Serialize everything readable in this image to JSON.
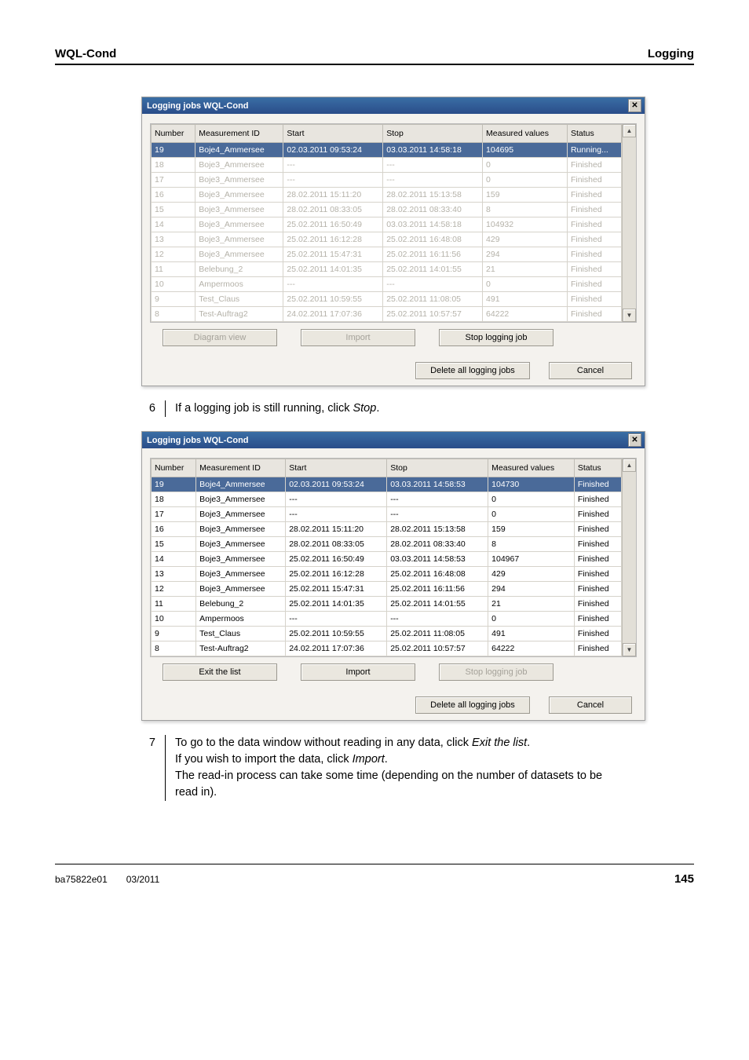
{
  "header": {
    "left": "WQL-Cond",
    "right": "Logging"
  },
  "dialog_title": "Logging jobs WQL-Cond",
  "columns": {
    "number": "Number",
    "id": "Measurement ID",
    "start": "Start",
    "stop": "Stop",
    "values": "Measured values",
    "status": "Status"
  },
  "dialog1": {
    "rows": [
      {
        "n": "19",
        "id": "Boje4_Ammersee",
        "start": "02.03.2011 09:53:24",
        "stop": "03.03.2011 14:58:18",
        "v": "104695",
        "s": "Running...",
        "sel": true
      },
      {
        "n": "18",
        "id": "Boje3_Ammersee",
        "start": "---",
        "stop": "---",
        "v": "0",
        "s": "Finished",
        "dis": true
      },
      {
        "n": "17",
        "id": "Boje3_Ammersee",
        "start": "---",
        "stop": "---",
        "v": "0",
        "s": "Finished",
        "dis": true
      },
      {
        "n": "16",
        "id": "Boje3_Ammersee",
        "start": "28.02.2011 15:11:20",
        "stop": "28.02.2011 15:13:58",
        "v": "159",
        "s": "Finished",
        "dis": true
      },
      {
        "n": "15",
        "id": "Boje3_Ammersee",
        "start": "28.02.2011 08:33:05",
        "stop": "28.02.2011 08:33:40",
        "v": "8",
        "s": "Finished",
        "dis": true
      },
      {
        "n": "14",
        "id": "Boje3_Ammersee",
        "start": "25.02.2011 16:50:49",
        "stop": "03.03.2011 14:58:18",
        "v": "104932",
        "s": "Finished",
        "dis": true
      },
      {
        "n": "13",
        "id": "Boje3_Ammersee",
        "start": "25.02.2011 16:12:28",
        "stop": "25.02.2011 16:48:08",
        "v": "429",
        "s": "Finished",
        "dis": true
      },
      {
        "n": "12",
        "id": "Boje3_Ammersee",
        "start": "25.02.2011 15:47:31",
        "stop": "25.02.2011 16:11:56",
        "v": "294",
        "s": "Finished",
        "dis": true
      },
      {
        "n": "11",
        "id": "Belebung_2",
        "start": "25.02.2011 14:01:35",
        "stop": "25.02.2011 14:01:55",
        "v": "21",
        "s": "Finished",
        "dis": true
      },
      {
        "n": "10",
        "id": "Ampermoos",
        "start": "---",
        "stop": "---",
        "v": "0",
        "s": "Finished",
        "dis": true
      },
      {
        "n": "9",
        "id": "Test_Claus",
        "start": "25.02.2011 10:59:55",
        "stop": "25.02.2011 11:08:05",
        "v": "491",
        "s": "Finished",
        "dis": true
      },
      {
        "n": "8",
        "id": "Test-Auftrag2",
        "start": "24.02.2011 17:07:36",
        "stop": "25.02.2011 10:57:57",
        "v": "64222",
        "s": "Finished",
        "dis": true
      }
    ],
    "buttons": {
      "left": "Diagram view",
      "import": "Import",
      "stop": "Stop logging job",
      "delete": "Delete all logging jobs",
      "cancel": "Cancel"
    }
  },
  "dialog2": {
    "rows": [
      {
        "n": "19",
        "id": "Boje4_Ammersee",
        "start": "02.03.2011 09:53:24",
        "stop": "03.03.2011 14:58:53",
        "v": "104730",
        "s": "Finished",
        "sel": true
      },
      {
        "n": "18",
        "id": "Boje3_Ammersee",
        "start": "---",
        "stop": "---",
        "v": "0",
        "s": "Finished"
      },
      {
        "n": "17",
        "id": "Boje3_Ammersee",
        "start": "---",
        "stop": "---",
        "v": "0",
        "s": "Finished"
      },
      {
        "n": "16",
        "id": "Boje3_Ammersee",
        "start": "28.02.2011 15:11:20",
        "stop": "28.02.2011 15:13:58",
        "v": "159",
        "s": "Finished"
      },
      {
        "n": "15",
        "id": "Boje3_Ammersee",
        "start": "28.02.2011 08:33:05",
        "stop": "28.02.2011 08:33:40",
        "v": "8",
        "s": "Finished"
      },
      {
        "n": "14",
        "id": "Boje3_Ammersee",
        "start": "25.02.2011 16:50:49",
        "stop": "03.03.2011 14:58:53",
        "v": "104967",
        "s": "Finished"
      },
      {
        "n": "13",
        "id": "Boje3_Ammersee",
        "start": "25.02.2011 16:12:28",
        "stop": "25.02.2011 16:48:08",
        "v": "429",
        "s": "Finished"
      },
      {
        "n": "12",
        "id": "Boje3_Ammersee",
        "start": "25.02.2011 15:47:31",
        "stop": "25.02.2011 16:11:56",
        "v": "294",
        "s": "Finished"
      },
      {
        "n": "11",
        "id": "Belebung_2",
        "start": "25.02.2011 14:01:35",
        "stop": "25.02.2011 14:01:55",
        "v": "21",
        "s": "Finished"
      },
      {
        "n": "10",
        "id": "Ampermoos",
        "start": "---",
        "stop": "---",
        "v": "0",
        "s": "Finished"
      },
      {
        "n": "9",
        "id": "Test_Claus",
        "start": "25.02.2011 10:59:55",
        "stop": "25.02.2011 11:08:05",
        "v": "491",
        "s": "Finished"
      },
      {
        "n": "8",
        "id": "Test-Auftrag2",
        "start": "24.02.2011 17:07:36",
        "stop": "25.02.2011 10:57:57",
        "v": "64222",
        "s": "Finished"
      }
    ],
    "buttons": {
      "left": "Exit the list",
      "import": "Import",
      "stop": "Stop logging job",
      "delete": "Delete all logging jobs",
      "cancel": "Cancel"
    }
  },
  "steps": {
    "s6_num": "6",
    "s6_a": "If a logging job is still running, click ",
    "s6_b": "Stop",
    "s6_c": ".",
    "s7_num": "7",
    "s7_a": "To go to the data window without reading in any data, click ",
    "s7_b": "Exit the list",
    "s7_c": ".",
    "s7_d": "If you wish to import the data, click ",
    "s7_e": "Import",
    "s7_f": ".",
    "s7_g": "The read-in process can take some time (depending on the number of datasets to be read in)."
  },
  "footer": {
    "doc": "ba75822e01",
    "date": "03/2011",
    "page": "145"
  }
}
